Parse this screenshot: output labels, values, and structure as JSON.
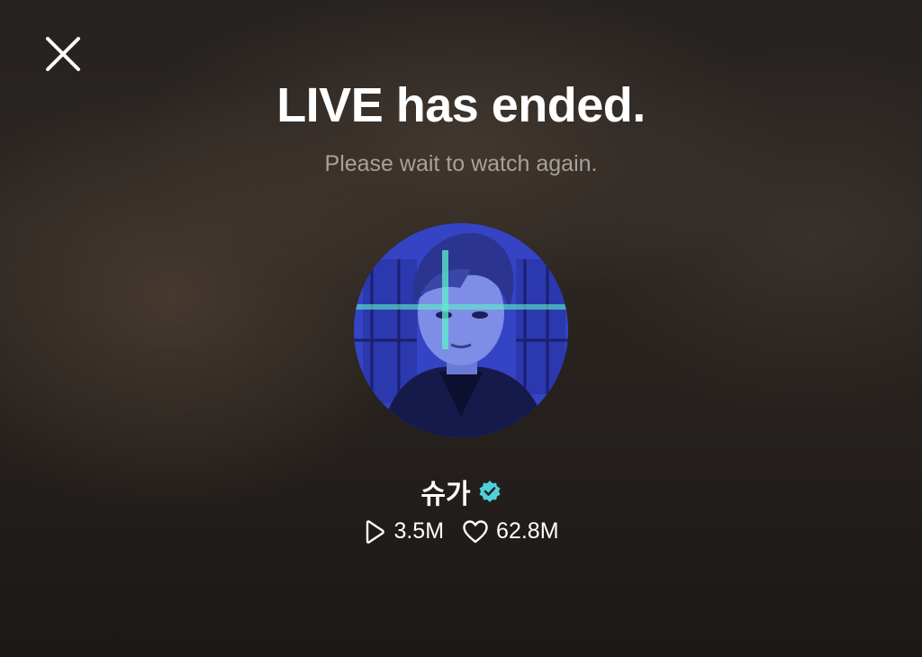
{
  "header": {
    "close_icon": "close-icon"
  },
  "main": {
    "title": "LIVE has ended.",
    "subtitle": "Please wait to watch again."
  },
  "profile": {
    "name": "슈가",
    "verified_icon": "verified-badge-icon",
    "verified_color": "#4fd1d9",
    "stats": {
      "plays": "3.5M",
      "likes": "62.8M"
    }
  },
  "colors": {
    "background": "#262220",
    "subtitle": "#a8a19b",
    "accent": "#4fd1d9"
  }
}
